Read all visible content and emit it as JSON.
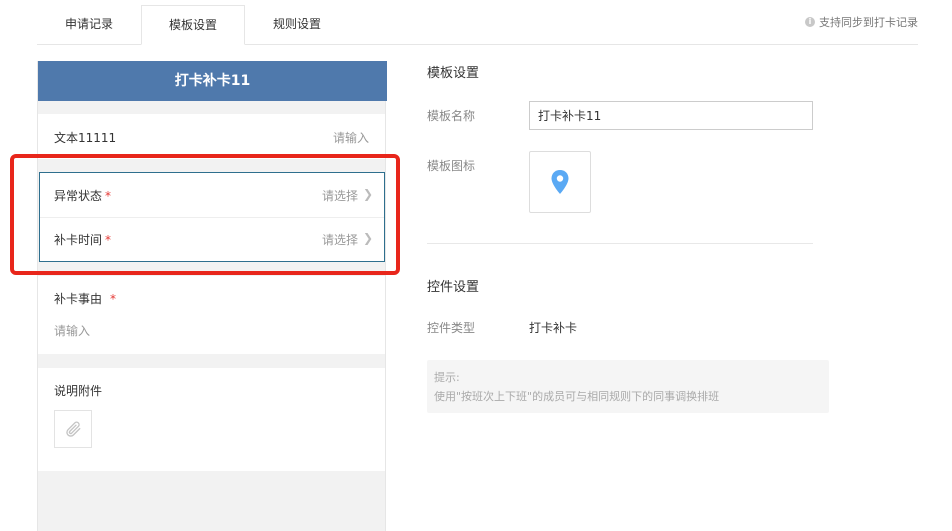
{
  "tabs": [
    {
      "label": "申请记录"
    },
    {
      "label": "模板设置"
    },
    {
      "label": "规则设置"
    }
  ],
  "sync_note": "支持同步到打卡记录",
  "preview": {
    "title": "打卡补卡11",
    "text_field": {
      "label": "文本11111",
      "placeholder": "请输入"
    },
    "group": [
      {
        "label": "异常状态",
        "placeholder": "请选择"
      },
      {
        "label": "补卡时间",
        "placeholder": "请选择"
      }
    ],
    "required_mark": "*",
    "reason": {
      "label": "补卡事由",
      "placeholder": "请输入"
    },
    "attachment": {
      "label": "说明附件"
    }
  },
  "settings": {
    "template_title": "模板设置",
    "name_label": "模板名称",
    "name_value": "打卡补卡11",
    "icon_label": "模板图标",
    "control_title": "控件设置",
    "control_type_label": "控件类型",
    "control_type_value": "打卡补卡",
    "tip_title": "提示:",
    "tip_text": "使用\"按班次上下班\"的成员可与相同规则下的同事调换排班"
  },
  "colors": {
    "header_bg": "#4f79ac",
    "highlight": "#e8261b",
    "required": "#e53935",
    "pin_icon": "#5aa9f4"
  },
  "icons": {
    "sync_info": "info-icon",
    "chevron": "chevron-right-icon",
    "attachment": "paperclip-icon",
    "template": "location-pin-icon"
  }
}
